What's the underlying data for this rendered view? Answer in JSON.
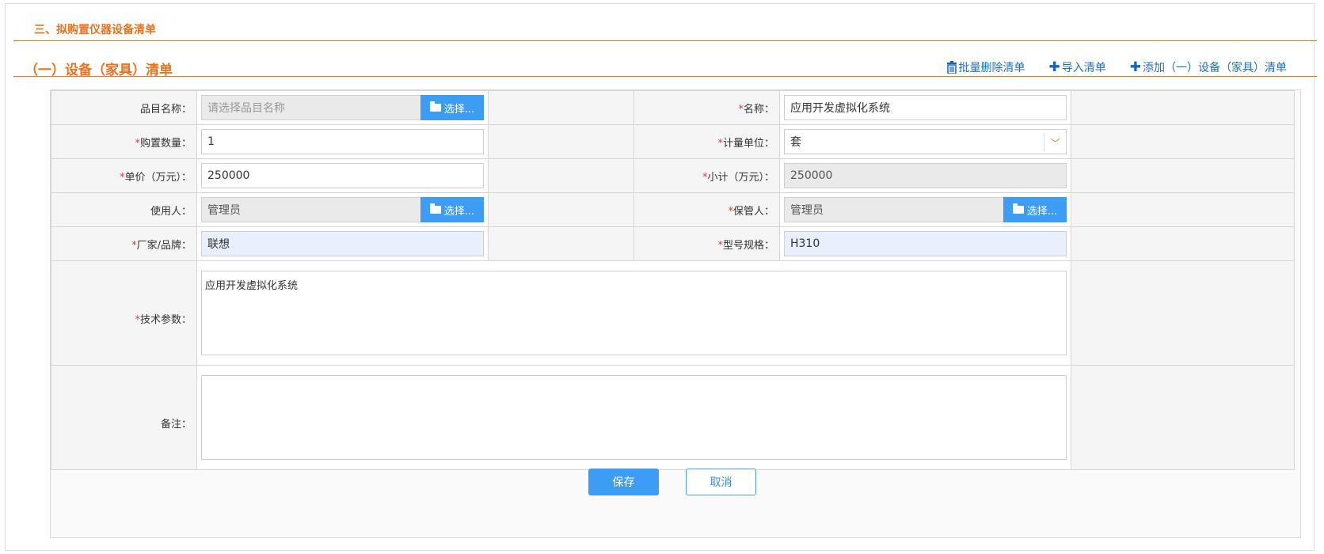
{
  "section": {
    "title": "三、拟购置仪器设备清单"
  },
  "subsection": {
    "title": "（一）设备（家具）清单",
    "actions": {
      "batch_delete": "批量删除清单",
      "import": "导入清单",
      "add": "添加（一）设备（家具）清单"
    }
  },
  "form": {
    "item_name": {
      "label": "品目名称：",
      "placeholder": "请选择品目名称",
      "button": "选择..."
    },
    "name": {
      "required": "*",
      "label": "名称：",
      "value": "应用开发虚拟化系统"
    },
    "quantity": {
      "required": "*",
      "label": "购置数量：",
      "value": "1"
    },
    "unit": {
      "required": "*",
      "label": "计量单位：",
      "value": "套"
    },
    "unit_price": {
      "required": "*",
      "label": "单价（万元）：",
      "value": "250000"
    },
    "subtotal": {
      "required": "*",
      "label": "小计（万元）：",
      "value": "250000"
    },
    "user": {
      "label": "使用人：",
      "value": "管理员",
      "button": "选择..."
    },
    "custodian": {
      "required": "*",
      "label": "保管人：",
      "value": "管理员",
      "button": "选择..."
    },
    "brand": {
      "required": "*",
      "label": "厂家/品牌：",
      "value": "联想"
    },
    "model": {
      "required": "*",
      "label": "型号规格：",
      "value": "H310"
    },
    "tech_params": {
      "required": "*",
      "label": "技术参数：",
      "value": "应用开发虚拟化系统"
    },
    "remarks": {
      "label": "备注：",
      "value": ""
    }
  },
  "buttons": {
    "save": "保存",
    "cancel": "取消"
  },
  "colors": {
    "accent_orange": "#e8731f",
    "primary_blue": "#3d9df5",
    "link_blue": "#1f6fb7",
    "required_red": "#e53935"
  }
}
